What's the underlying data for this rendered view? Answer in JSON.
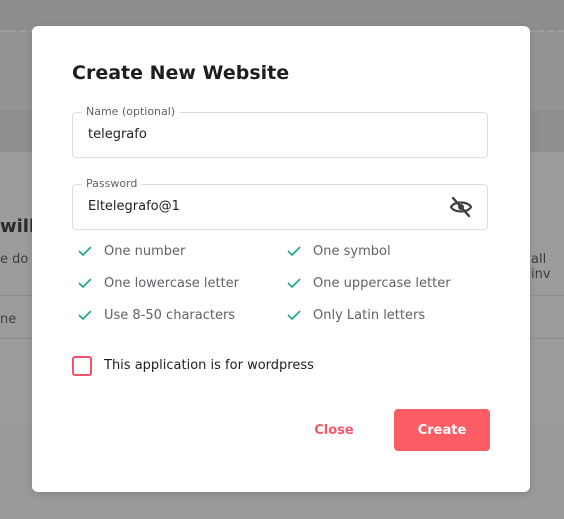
{
  "background": {
    "heading_fragment": "will",
    "text_fragment_left": "e do",
    "text_fragment_right": "all inv",
    "row_fragment": "ne"
  },
  "dialog": {
    "title": "Create New Website",
    "name_field": {
      "label": "Name (optional)",
      "value": "telegrafo"
    },
    "password_field": {
      "label": "Password",
      "value": "Eltelegrafo@1"
    },
    "rules": [
      "One number",
      "One symbol",
      "One lowercase letter",
      "One uppercase letter",
      "Use 8-50 characters",
      "Only Latin letters"
    ],
    "checkbox_label": "This application is for wordpress",
    "close_label": "Close",
    "create_label": "Create"
  },
  "colors": {
    "check": "#1aa687",
    "accent": "#fc5c64",
    "title": "#1d1e20"
  }
}
